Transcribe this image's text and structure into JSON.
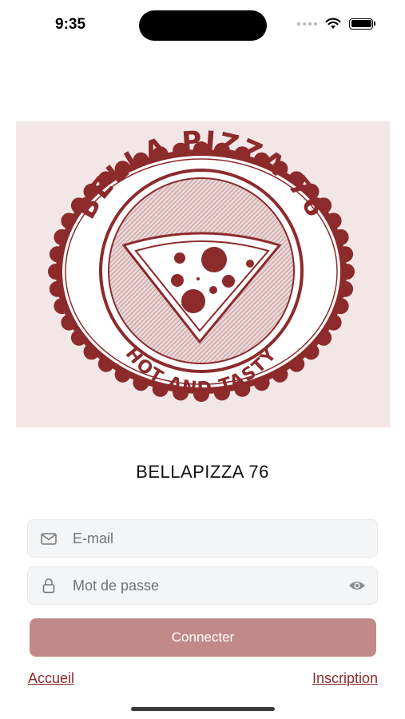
{
  "status_bar": {
    "time": "9:35"
  },
  "logo": {
    "top_text": "BELLA PIZZA 76",
    "bottom_text": "HOT AND TASTY",
    "accent_color": "#8c2a2c",
    "background_color": "#f3e6e6"
  },
  "app_name": "BELLAPIZZA 76",
  "form": {
    "email": {
      "placeholder": "E-mail",
      "value": "",
      "icon": "mail-icon"
    },
    "password": {
      "placeholder": "Mot de passe",
      "value": "",
      "icon": "lock-icon",
      "toggle_icon": "eye-icon"
    },
    "submit_label": "Connecter",
    "submit_color": "#c18a88"
  },
  "links": {
    "left": "Accueil",
    "right": "Inscription",
    "color": "#8b2a2a"
  }
}
